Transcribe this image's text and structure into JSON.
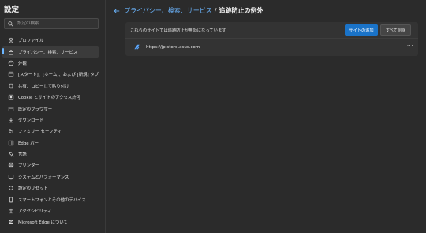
{
  "sidebar": {
    "title": "設定",
    "search_placeholder": "設定の検索",
    "items": [
      {
        "label": "プロファイル",
        "icon": "profile-icon"
      },
      {
        "label": "プライバシー、検索、サービス",
        "icon": "lock-icon",
        "active": true
      },
      {
        "label": "外観",
        "icon": "appearance-icon"
      },
      {
        "label": "[スタート]、[ホーム]、および [新規] タブ",
        "icon": "home-tab-icon"
      },
      {
        "label": "共有、コピーして貼り付け",
        "icon": "share-icon"
      },
      {
        "label": "Cookie とサイトのアクセス許可",
        "icon": "cookie-icon"
      },
      {
        "label": "既定のブラウザー",
        "icon": "browser-icon"
      },
      {
        "label": "ダウンロード",
        "icon": "download-icon"
      },
      {
        "label": "ファミリー セーフティ",
        "icon": "family-icon"
      },
      {
        "label": "Edge バー",
        "icon": "edge-bar-icon"
      },
      {
        "label": "言語",
        "icon": "language-icon"
      },
      {
        "label": "プリンター",
        "icon": "printer-icon"
      },
      {
        "label": "システムとパフォーマンス",
        "icon": "system-icon"
      },
      {
        "label": "設定のリセット",
        "icon": "reset-icon"
      },
      {
        "label": "スマートフォンとその他のデバイス",
        "icon": "phone-icon"
      },
      {
        "label": "アクセシビリティ",
        "icon": "accessibility-icon"
      },
      {
        "label": "Microsoft Edge について",
        "icon": "edge-logo-icon"
      }
    ]
  },
  "header": {
    "breadcrumb_link": "プライバシー、検索、サービス",
    "separator": "/",
    "current": "追跡防止の例外"
  },
  "card": {
    "description": "これらのサイトでは追跡防止が無効になっています",
    "add_button": "サイトの追加",
    "remove_all_button": "すべて削除",
    "sites": [
      {
        "url": "https://jp.store.asus.com",
        "icon": "asus-logo-icon"
      }
    ],
    "more_label": "···"
  },
  "colors": {
    "accent": "#6cb6ff",
    "primary_button": "#1a73c8",
    "background": "#2b2b2b",
    "card": "#333333"
  }
}
